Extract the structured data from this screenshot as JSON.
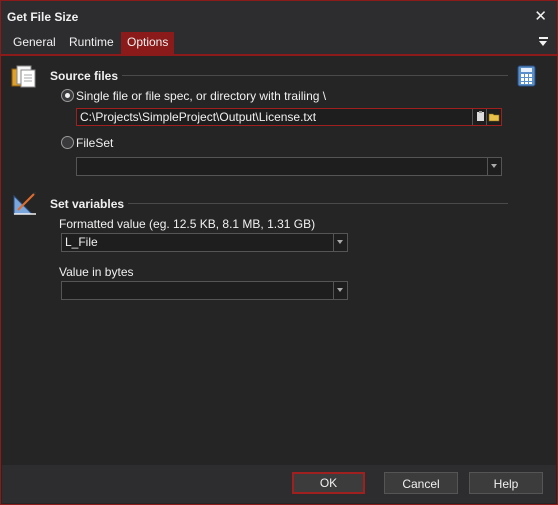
{
  "window": {
    "title": "Get File Size"
  },
  "tabs": [
    {
      "label": "General"
    },
    {
      "label": "Runtime"
    },
    {
      "label": "Options"
    }
  ],
  "active_tab": "Options",
  "source_files": {
    "title": "Source files",
    "radio_single_label": "Single file or file spec, or directory with trailing \\",
    "path_value": "C:\\Projects\\SimpleProject\\Output\\License.txt",
    "radio_fileset_label": "FileSet",
    "fileset_value": ""
  },
  "set_variables": {
    "title": "Set variables",
    "formatted_label": "Formatted value (eg. 12.5 KB, 8.1 MB, 1.31 GB)",
    "formatted_value": "L_File",
    "bytes_label": "Value in bytes",
    "bytes_value": ""
  },
  "footer": {
    "ok_label": "OK",
    "cancel_label": "Cancel",
    "help_label": "Help"
  },
  "colors": {
    "accent": "#8b1a1a",
    "background": "#252526",
    "panel": "#2d2d30",
    "input_bg": "#1e1e1e"
  }
}
